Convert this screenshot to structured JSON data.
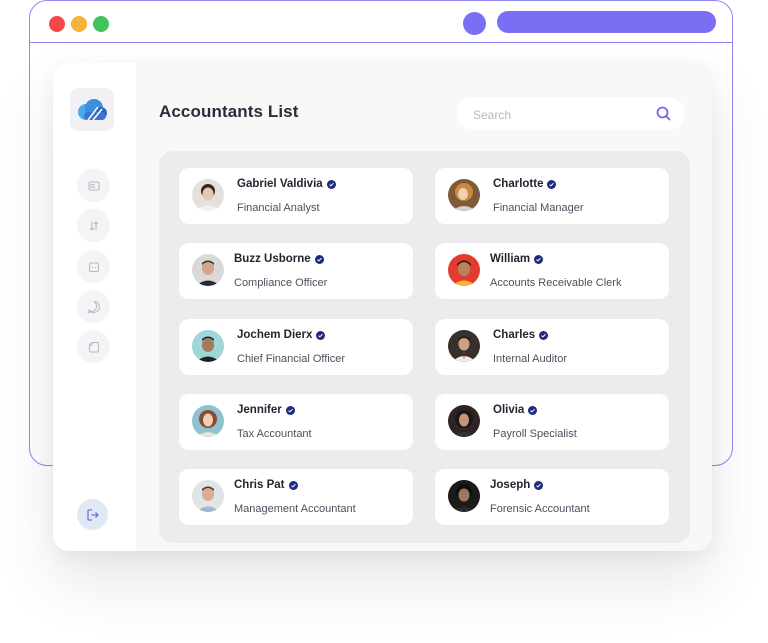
{
  "window": {
    "controls": [
      "close",
      "minimize",
      "maximize"
    ]
  },
  "colors": {
    "accent": "#7a6ff4",
    "verified": "#1f2b7b",
    "panel_bg": "#ececee"
  },
  "page": {
    "title": "Accountants List"
  },
  "search": {
    "placeholder": "Search",
    "icon": "search-icon"
  },
  "sidebar": {
    "logo": "cloud-logo",
    "items": [
      {
        "icon": "wallet-icon"
      },
      {
        "icon": "transfer-icon"
      },
      {
        "icon": "calendar-icon"
      },
      {
        "icon": "chat-icon"
      },
      {
        "icon": "document-icon"
      }
    ],
    "logout_icon": "logout-icon"
  },
  "accountants": [
    {
      "name": "Gabriel Valdivia",
      "role": "Financial Analyst",
      "verified": true
    },
    {
      "name": "Charlotte",
      "role": "Financial Manager",
      "verified": true
    },
    {
      "name": "Buzz Usborne",
      "role": "Compliance Officer",
      "verified": true
    },
    {
      "name": "William",
      "role": "Accounts Receivable Clerk",
      "verified": true
    },
    {
      "name": "Jochem Dierx",
      "role": "Chief Financial Officer",
      "verified": true
    },
    {
      "name": "Charles",
      "role": "Internal Auditor",
      "verified": true
    },
    {
      "name": "Jennifer",
      "role": "Tax Accountant",
      "verified": true
    },
    {
      "name": "Olivia",
      "role": "Payroll Specialist",
      "verified": true
    },
    {
      "name": "Chris Pat",
      "role": "Management Accountant",
      "verified": true
    },
    {
      "name": "Joseph",
      "role": "Forensic Accountant",
      "verified": true
    }
  ]
}
